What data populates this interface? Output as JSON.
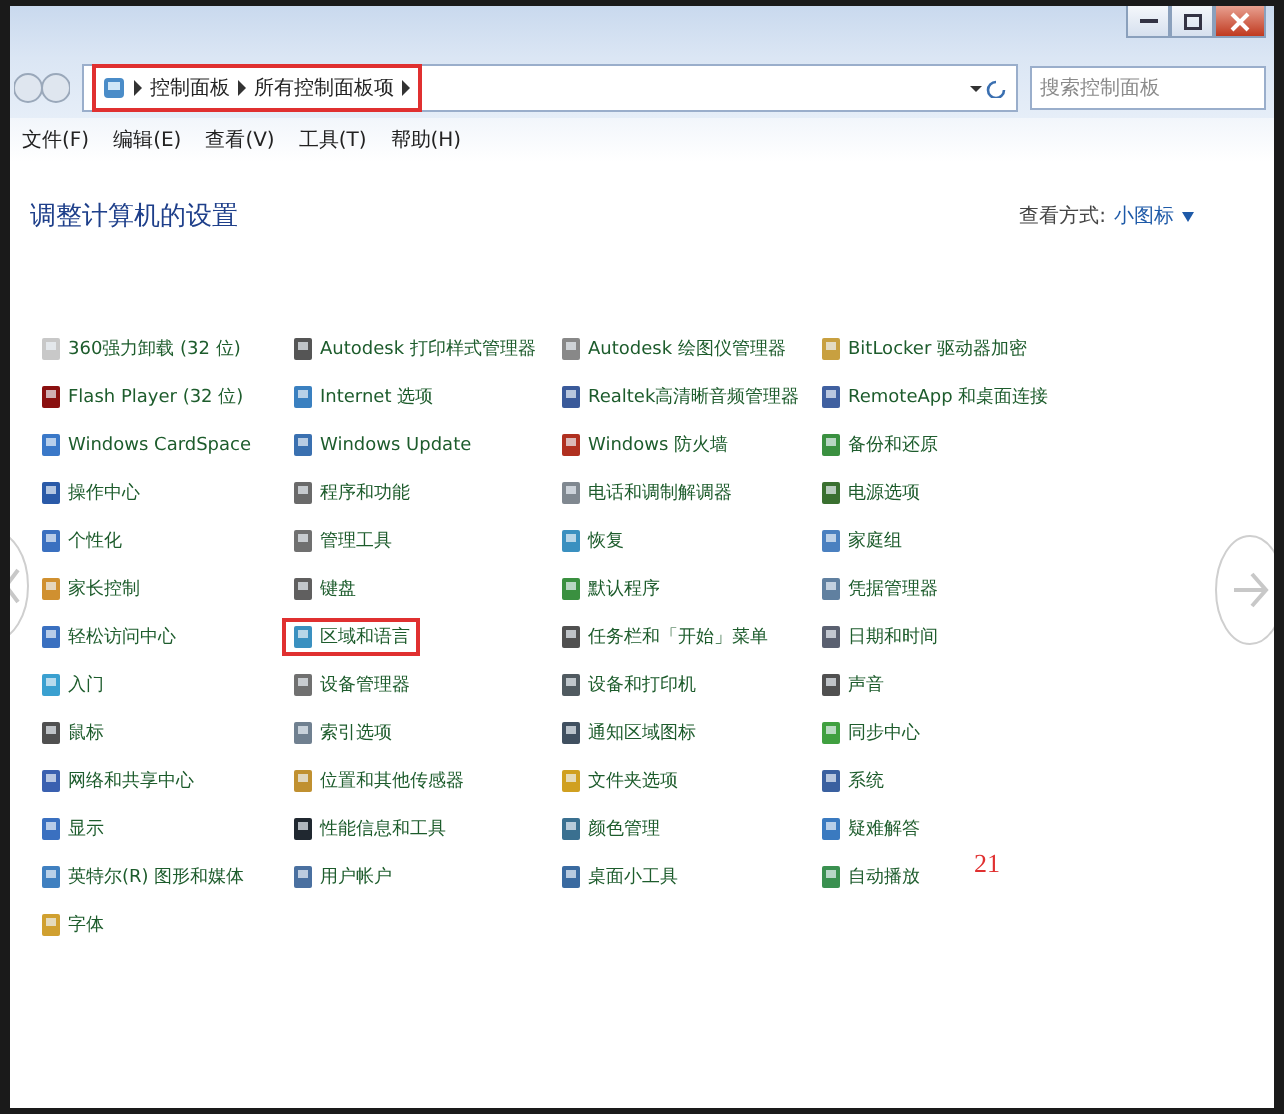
{
  "window": {
    "controls": [
      {
        "kind": "minimize"
      },
      {
        "kind": "maximize"
      },
      {
        "kind": "close"
      }
    ]
  },
  "address_bar": {
    "boxed": true,
    "breadcrumb": [
      "控制面板",
      "所有控制面板项"
    ]
  },
  "search": {
    "placeholder": "搜索控制面板"
  },
  "menu": [
    "文件(F)",
    "编辑(E)",
    "查看(V)",
    "工具(T)",
    "帮助(H)"
  ],
  "heading": "调整计算机的设置",
  "view_by": {
    "label": "查看方式:",
    "value": "小图标"
  },
  "items": [
    {
      "label": "360强力卸载 (32 位)",
      "boxed": false
    },
    {
      "label": "Autodesk 打印样式管理器",
      "boxed": false
    },
    {
      "label": "Autodesk 绘图仪管理器",
      "boxed": false
    },
    {
      "label": "BitLocker 驱动器加密",
      "boxed": false
    },
    {
      "label": "Flash Player (32 位)",
      "boxed": false
    },
    {
      "label": "Internet 选项",
      "boxed": false
    },
    {
      "label": "Realtek高清晰音频管理器",
      "boxed": false
    },
    {
      "label": "RemoteApp 和桌面连接",
      "boxed": false
    },
    {
      "label": "Windows CardSpace",
      "boxed": false
    },
    {
      "label": "Windows Update",
      "boxed": false
    },
    {
      "label": "Windows 防火墙",
      "boxed": false
    },
    {
      "label": "备份和还原",
      "boxed": false
    },
    {
      "label": "操作中心",
      "boxed": false
    },
    {
      "label": "程序和功能",
      "boxed": false
    },
    {
      "label": "电话和调制解调器",
      "boxed": false
    },
    {
      "label": "电源选项",
      "boxed": false
    },
    {
      "label": "个性化",
      "boxed": false
    },
    {
      "label": "管理工具",
      "boxed": false
    },
    {
      "label": "恢复",
      "boxed": false
    },
    {
      "label": "家庭组",
      "boxed": false
    },
    {
      "label": "家长控制",
      "boxed": false
    },
    {
      "label": "键盘",
      "boxed": false
    },
    {
      "label": "默认程序",
      "boxed": false
    },
    {
      "label": "凭据管理器",
      "boxed": false
    },
    {
      "label": "轻松访问中心",
      "boxed": false
    },
    {
      "label": "区域和语言",
      "boxed": true
    },
    {
      "label": "任务栏和「开始」菜单",
      "boxed": false
    },
    {
      "label": "日期和时间",
      "boxed": false
    },
    {
      "label": "入门",
      "boxed": false
    },
    {
      "label": "设备管理器",
      "boxed": false
    },
    {
      "label": "设备和打印机",
      "boxed": false
    },
    {
      "label": "声音",
      "boxed": false
    },
    {
      "label": "鼠标",
      "boxed": false
    },
    {
      "label": "索引选项",
      "boxed": false
    },
    {
      "label": "通知区域图标",
      "boxed": false
    },
    {
      "label": "同步中心",
      "boxed": false
    },
    {
      "label": "网络和共享中心",
      "boxed": false
    },
    {
      "label": "位置和其他传感器",
      "boxed": false
    },
    {
      "label": "文件夹选项",
      "boxed": false
    },
    {
      "label": "系统",
      "boxed": false
    },
    {
      "label": "显示",
      "boxed": false
    },
    {
      "label": "性能信息和工具",
      "boxed": false
    },
    {
      "label": "颜色管理",
      "boxed": false
    },
    {
      "label": "疑难解答",
      "boxed": false
    },
    {
      "label": "英特尔(R) 图形和媒体",
      "boxed": false
    },
    {
      "label": "用户帐户",
      "boxed": false
    },
    {
      "label": "桌面小工具",
      "boxed": false
    },
    {
      "label": "自动播放",
      "boxed": false
    },
    {
      "label": "字体",
      "boxed": false
    }
  ],
  "annotation": "21"
}
